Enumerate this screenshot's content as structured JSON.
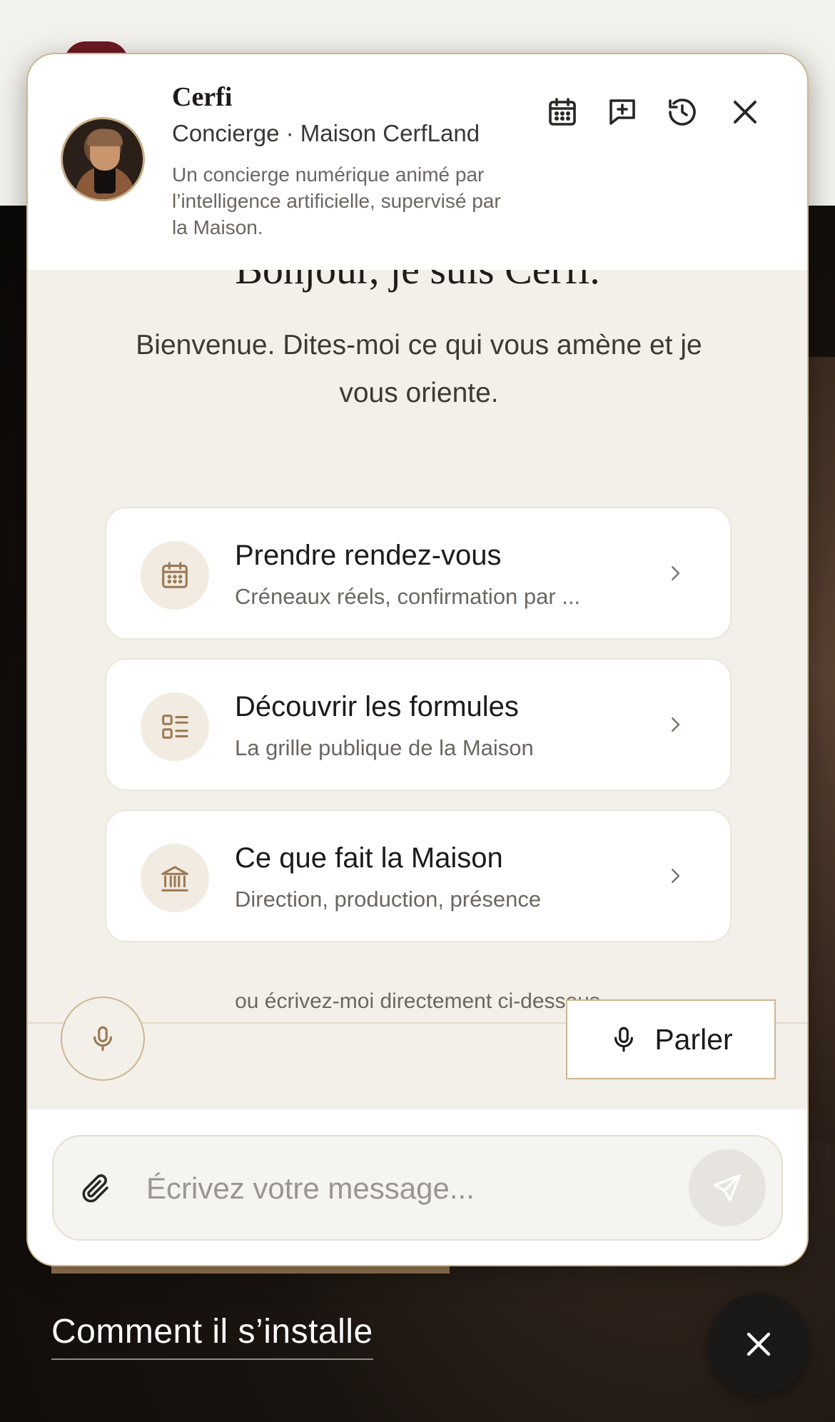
{
  "colors": {
    "accent": "#9b7a55",
    "panel_border": "#cdb690",
    "panel_bg": "#f3f0ea"
  },
  "header": {
    "name": "Cerfi",
    "role": "Concierge · Maison CerfLand",
    "description": "Un concierge numérique animé par l’intelligence artificielle, supervisé par la Maison.",
    "icons": [
      "calendar-icon",
      "new-chat-icon",
      "history-icon",
      "close-icon"
    ]
  },
  "intro": {
    "greeting": "Bonjour, je suis Cerfi.",
    "welcome": "Bienvenue. Dites-moi ce qui vous amène et je vous oriente."
  },
  "cards": [
    {
      "title": "Prendre rendez-vous",
      "subtitle": "Créneaux réels, confirmation par ...",
      "icon": "calendar-icon"
    },
    {
      "title": "Découvrir les formules",
      "subtitle": "La grille publique de la Maison",
      "icon": "list-icon"
    },
    {
      "title": "Ce que fait la Maison",
      "subtitle": "Direction, production, présence",
      "icon": "institution-icon"
    }
  ],
  "hint": "ou écrivez-moi directement ci-dessous",
  "voice": {
    "talk_label": "Parler"
  },
  "composer": {
    "placeholder": "Écrivez votre message..."
  },
  "background": {
    "link_text": "Comment il s’installe"
  }
}
